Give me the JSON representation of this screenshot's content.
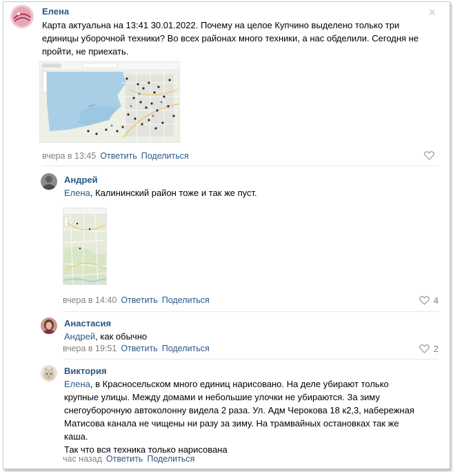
{
  "close_icon": "×",
  "comments": [
    {
      "author": "Елена",
      "text": "Карта актуальна на 13:41 30.01.2022. Почему на целое Купчино выделено только три единицы уборочной техники? Во всех районах много техники, а нас обделили. Сегодня не пройти, не приехать.",
      "time": "вчера в 13:45",
      "reply_label": "Ответить",
      "share_label": "Поделиться",
      "likes": ""
    },
    {
      "author": "Андрей",
      "reply_to": "Елена",
      "text": ", Калининский район тоже и так же пуст.",
      "time": "вчера в 14:40",
      "reply_label": "Ответить",
      "share_label": "Поделиться",
      "likes": "4"
    },
    {
      "author": "Анастасия",
      "reply_to": "Андрей",
      "text": ", как обычно",
      "time": "вчера в 19:51",
      "reply_label": "Ответить",
      "share_label": "Поделиться",
      "likes": "2"
    },
    {
      "author": "Виктория",
      "reply_to": "Елена",
      "text_lines": [
        ", в Красносельском много единиц нарисовано. На деле убирают только",
        "крупные улицы. Между домами и небольшие улочки не убираются. За зиму",
        "снегоуборочную автоколонну видела 2 раза. Ул. Адм Черокова 18 к2,3, набережная",
        "Матисова канала не чищены ни разу за зиму. На трамвайных остановках так же",
        "каша.",
        "Так что вся техника только нарисована"
      ],
      "time": "час назад",
      "reply_label": "Ответить",
      "share_label": "Поделиться",
      "likes": ""
    }
  ],
  "colors": {
    "link": "#2a5885",
    "meta": "#828282",
    "heart": "#99a2ad"
  }
}
